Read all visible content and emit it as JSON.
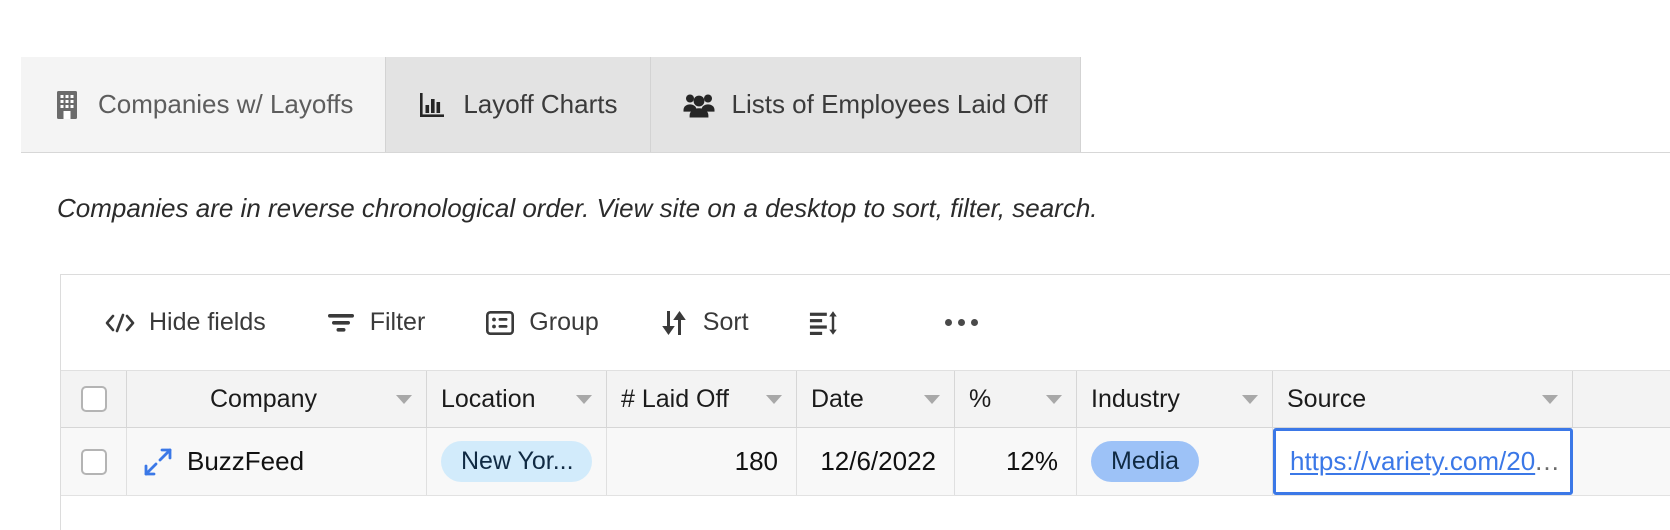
{
  "tabs": [
    {
      "label": "Companies w/ Layoffs",
      "icon": "building-icon",
      "state": "active"
    },
    {
      "label": "Layoff Charts",
      "icon": "bar-chart-icon",
      "state": "inactive"
    },
    {
      "label": "Lists of Employees Laid Off",
      "icon": "people-group-icon",
      "state": "inactive"
    }
  ],
  "description": "Companies are in reverse chronological order. View site on a desktop to sort, filter, search.",
  "toolbar": {
    "hide_fields": "Hide fields",
    "filter": "Filter",
    "group": "Group",
    "sort": "Sort",
    "row_height_icon": "row-height-icon",
    "more_icon": "more-options-icon"
  },
  "table": {
    "columns": [
      {
        "label": "Company"
      },
      {
        "label": "Location"
      },
      {
        "label": "# Laid Off"
      },
      {
        "label": "Date"
      },
      {
        "label": "%"
      },
      {
        "label": "Industry"
      },
      {
        "label": "Source"
      }
    ],
    "rows": [
      {
        "company": "BuzzFeed",
        "location": "New Yor...",
        "laid_off": "180",
        "date": "12/6/2022",
        "percent": "12%",
        "industry": "Media",
        "source": "https://variety.com/20",
        "source_ellipsis": "..."
      }
    ]
  },
  "colors": {
    "accent_blue": "#3b78e7",
    "location_pill_bg": "#d2ebfb",
    "industry_pill_bg": "#9dc2f7",
    "tab_active_bg": "#f4f4f4",
    "tab_inactive_bg": "#e3e3e3"
  }
}
